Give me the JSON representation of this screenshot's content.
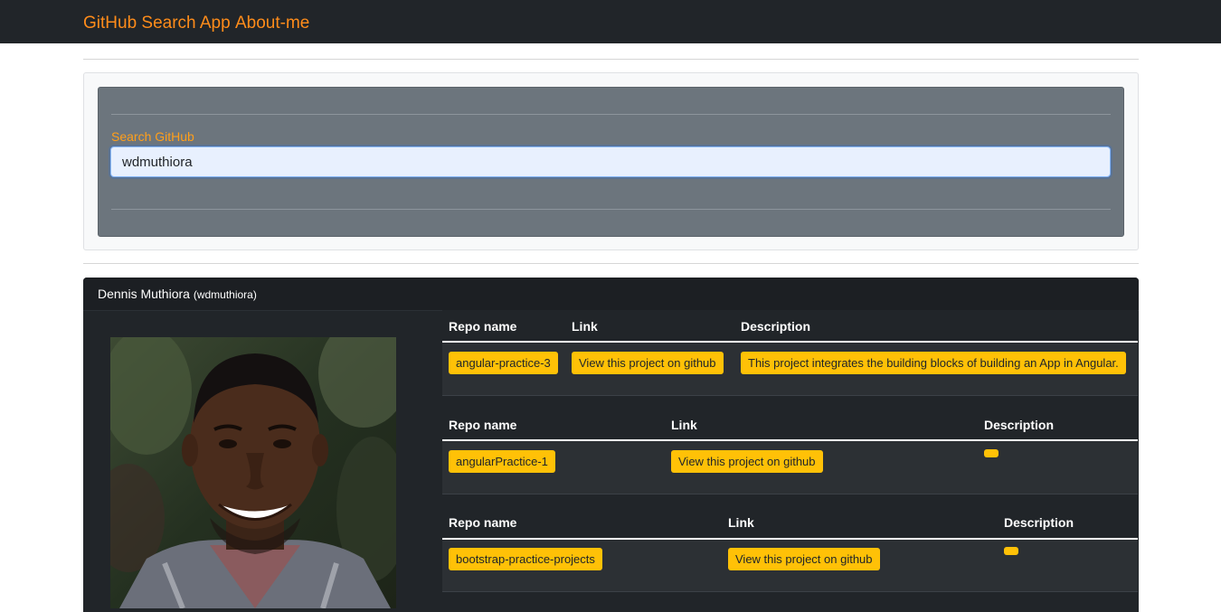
{
  "nav": {
    "brand": "GitHub Search App",
    "about": "About-me"
  },
  "search": {
    "label": "Search GitHub",
    "value": "wdmuthiora"
  },
  "profile": {
    "name": "Dennis Muthiora",
    "login": "(wdmuthiora)"
  },
  "repos": {
    "headers": {
      "repo_name": "Repo name",
      "link": "Link",
      "description": "Description"
    },
    "items": [
      {
        "name": "angular-practice-3",
        "link_label": "View this project on github",
        "description": "This project integrates the building blocks of building an App in Angular."
      },
      {
        "name": "angularPractice-1",
        "link_label": "View this project on github",
        "description": ""
      },
      {
        "name": "bootstrap-practice-projects",
        "link_label": "View this project on github",
        "description": ""
      }
    ]
  },
  "colors": {
    "navbar_bg": "#212529",
    "nav_link": "#ff8c1a",
    "badge": "#ffc107",
    "search_card_bg": "#6c757d"
  }
}
